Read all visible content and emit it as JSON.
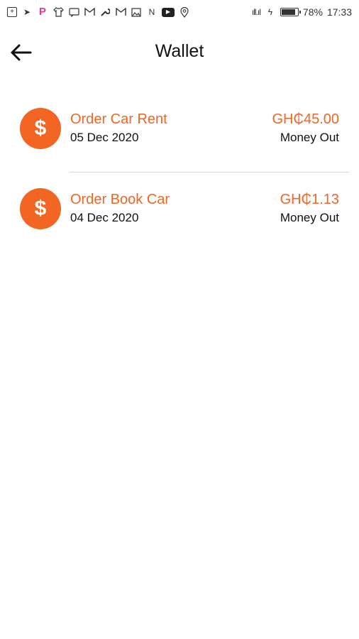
{
  "status_bar": {
    "battery_text": "78%",
    "battery_level": 0.78,
    "time": "17:33",
    "signal_text": "ıll.ıl",
    "icons": [
      "plus-box-icon",
      "arrow-app-icon",
      "pinterest-icon",
      "tshirt-icon",
      "message-icon",
      "gmail-icon",
      "wrench-icon",
      "gmail-icon",
      "image-icon",
      "n-icon",
      "youtube-icon",
      "location-icon",
      "signal-icon",
      "charging-icon",
      "battery-icon"
    ]
  },
  "header": {
    "title": "Wallet",
    "back_icon": "arrow-left-icon"
  },
  "transactions": [
    {
      "title": "Order Car Rent",
      "date": "05 Dec 2020",
      "amount": "GH₵45.00",
      "direction": "Money Out",
      "icon": "dollar-icon",
      "icon_glyph": "$"
    },
    {
      "title": "Order Book Car",
      "date": "04 Dec 2020",
      "amount": "GH₵1.13",
      "direction": "Money Out",
      "icon": "dollar-icon",
      "icon_glyph": "$"
    }
  ],
  "colors": {
    "accent": "#f26522",
    "text": "#111111",
    "divider": "#d8d8d8",
    "background": "#ffffff"
  }
}
